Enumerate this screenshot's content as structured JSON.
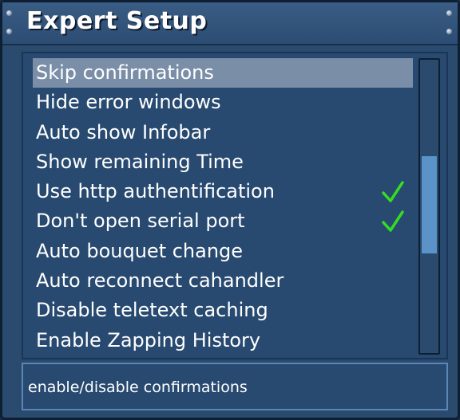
{
  "window": {
    "title": "Expert Setup"
  },
  "menu": {
    "items": [
      {
        "label": "Skip confirmations",
        "checked": false,
        "selected": true
      },
      {
        "label": "Hide error windows",
        "checked": false,
        "selected": false
      },
      {
        "label": "Auto show Infobar",
        "checked": false,
        "selected": false
      },
      {
        "label": "Show remaining Time",
        "checked": false,
        "selected": false
      },
      {
        "label": "Use http authentification",
        "checked": true,
        "selected": false
      },
      {
        "label": "Don't open serial port",
        "checked": true,
        "selected": false
      },
      {
        "label": "Auto bouquet change",
        "checked": false,
        "selected": false
      },
      {
        "label": "Auto reconnect cahandler",
        "checked": false,
        "selected": false
      },
      {
        "label": "Disable teletext caching",
        "checked": false,
        "selected": false
      },
      {
        "label": "Enable Zapping History",
        "checked": false,
        "selected": false
      }
    ]
  },
  "scrollbar": {
    "thumb_start_fraction": 0.33,
    "thumb_end_fraction": 0.66
  },
  "status": {
    "text": "enable/disable confirmations"
  },
  "colors": {
    "check": "#33dd22",
    "selected_bg": "#7a8ea8",
    "scroll_thumb": "#5b93c9"
  },
  "icons": {
    "check": "checkmark-icon",
    "screw": "screw-icon"
  }
}
